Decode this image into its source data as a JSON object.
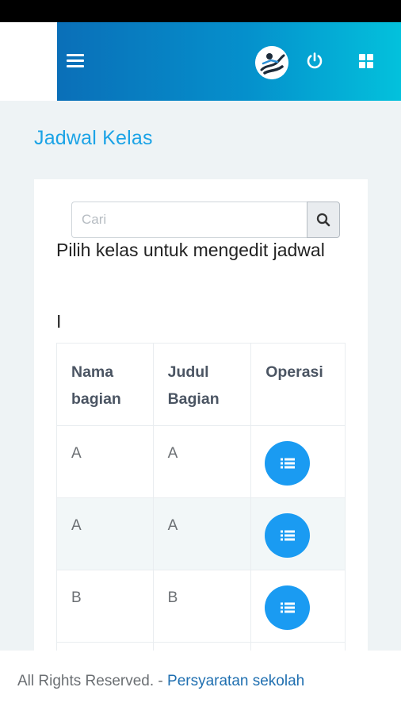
{
  "header": {
    "menu_icon": "hamburger-icon",
    "avatar_icon": "user-avatar",
    "power_icon": "power-icon",
    "apps_icon": "grid-icon",
    "colors": {
      "gradient_start": "#0a6fb8",
      "gradient_end": "#03c1dc"
    }
  },
  "page": {
    "title": "Jadwal Kelas",
    "title_color": "#1ba3e6"
  },
  "search": {
    "placeholder": "Cari",
    "value": "",
    "icon": "search-icon"
  },
  "instruction": "Pilih kelas untuk mengedit jadwal",
  "cursor_text": "I",
  "table": {
    "headers": [
      "Nama bagian",
      "Judul Bagian",
      "Operasi"
    ],
    "rows": [
      {
        "nama": "A",
        "judul": "A"
      },
      {
        "nama": "A",
        "judul": "A"
      },
      {
        "nama": "B",
        "judul": "B"
      }
    ],
    "operation_icon": "list-icon",
    "operation_color": "#1a9bf2"
  },
  "footer": {
    "text": "All Rights Reserved. - ",
    "link": "Persyaratan sekolah"
  }
}
